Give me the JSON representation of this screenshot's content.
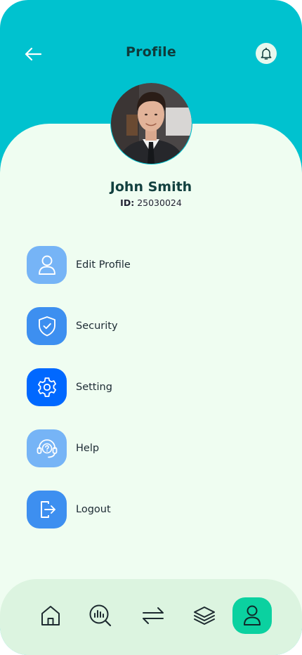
{
  "header": {
    "title": "Profile",
    "back_icon": "arrow-left-icon",
    "notification_icon": "bell-icon"
  },
  "profile": {
    "name": "John Smith",
    "id_label": "ID:",
    "id_value": "25030024",
    "avatar": "profile-photo"
  },
  "menu": {
    "items": [
      {
        "label": "Edit Profile",
        "icon": "user-icon",
        "color": "#76B4F6"
      },
      {
        "label": "Security",
        "icon": "shield-check-icon",
        "color": "#3D8FF0"
      },
      {
        "label": "Setting",
        "icon": "gear-icon",
        "color": "#0068FF"
      },
      {
        "label": "Help",
        "icon": "headset-help-icon",
        "color": "#76B4F6"
      },
      {
        "label": "Logout",
        "icon": "logout-icon",
        "color": "#3D8FF0"
      }
    ]
  },
  "bottom_nav": {
    "items": [
      {
        "icon": "home-icon",
        "active": false
      },
      {
        "icon": "analytics-search-icon",
        "active": false
      },
      {
        "icon": "transfer-arrows-icon",
        "active": false
      },
      {
        "icon": "layers-icon",
        "active": false
      },
      {
        "icon": "user-icon",
        "active": true
      }
    ]
  },
  "colors": {
    "header_bg": "#00C2CF",
    "sheet_bg": "#EFFDF1",
    "nav_bg": "#DCF4E0",
    "nav_active": "#0BD1A0",
    "title_text": "#0F3B3B"
  }
}
